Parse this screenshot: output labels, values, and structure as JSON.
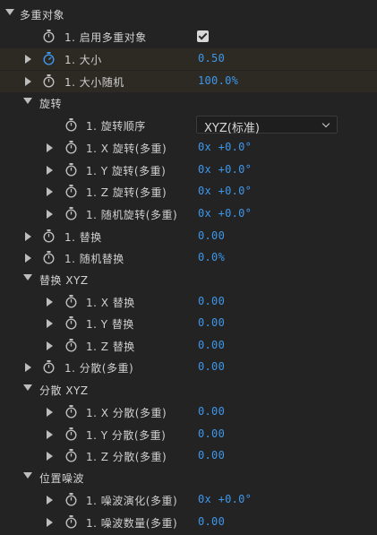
{
  "panel": {
    "rows": [
      {
        "kind": "group",
        "label": "多重对象",
        "expanded": true
      },
      {
        "kind": "prop",
        "label": "1. 启用多重对象",
        "control": "checkbox",
        "checked": true
      },
      {
        "kind": "prop",
        "label": "1. 大小",
        "value": "0.50",
        "keyframed": true,
        "expandable": true
      },
      {
        "kind": "prop",
        "label": "1. 大小随机",
        "value": "100.0%",
        "expandable": true
      },
      {
        "kind": "group",
        "label": "旋转",
        "expanded": true
      },
      {
        "kind": "prop",
        "label": "1. 旋转顺序",
        "control": "dropdown",
        "value": "XYZ(标准)"
      },
      {
        "kind": "prop",
        "label": "1. X 旋转(多重)",
        "value": "0x +0.0°",
        "expandable": true
      },
      {
        "kind": "prop",
        "label": "1. Y 旋转(多重)",
        "value": "0x +0.0°",
        "expandable": true
      },
      {
        "kind": "prop",
        "label": "1. Z 旋转(多重)",
        "value": "0x +0.0°",
        "expandable": true
      },
      {
        "kind": "prop",
        "label": "1. 随机旋转(多重)",
        "value": "0x +0.0°",
        "expandable": true
      },
      {
        "kind": "prop",
        "label": "1. 替换",
        "value": "0.00",
        "expandable": true
      },
      {
        "kind": "prop",
        "label": "1. 随机替换",
        "value": "0.0%",
        "expandable": true
      },
      {
        "kind": "group",
        "label": "替换 XYZ",
        "expanded": true
      },
      {
        "kind": "prop",
        "label": "1. X 替换",
        "value": "0.00",
        "expandable": true
      },
      {
        "kind": "prop",
        "label": "1. Y 替换",
        "value": "0.00",
        "expandable": true
      },
      {
        "kind": "prop",
        "label": "1. Z 替换",
        "value": "0.00",
        "expandable": true
      },
      {
        "kind": "prop",
        "label": "1. 分散(多重)",
        "value": "0.00",
        "expandable": true
      },
      {
        "kind": "group",
        "label": "分散 XYZ",
        "expanded": true
      },
      {
        "kind": "prop",
        "label": "1. X 分散(多重)",
        "value": "0.00",
        "expandable": true
      },
      {
        "kind": "prop",
        "label": "1. Y 分散(多重)",
        "value": "0.00",
        "expandable": true
      },
      {
        "kind": "prop",
        "label": "1. Z 分散(多重)",
        "value": "0.00",
        "expandable": true
      },
      {
        "kind": "group",
        "label": "位置噪波",
        "expanded": true
      },
      {
        "kind": "prop",
        "label": "1. 噪波演化(多重)",
        "value": "0x +0.0°",
        "expandable": true
      },
      {
        "kind": "prop",
        "label": "1. 噪波数量(多重)",
        "value": "0.00",
        "expandable": true
      }
    ]
  },
  "colors": {
    "background": "#232323",
    "value_blue": "#3e97ea",
    "highlight_row": "#2d2a24",
    "stopwatch_active": "#3e97ea",
    "stopwatch_idle": "#bdbdbd"
  },
  "icons": {
    "expand": "triangle-right-icon",
    "collapse": "triangle-down-icon",
    "stopwatch": "stopwatch-icon",
    "dropdown": "chevron-down-icon"
  }
}
